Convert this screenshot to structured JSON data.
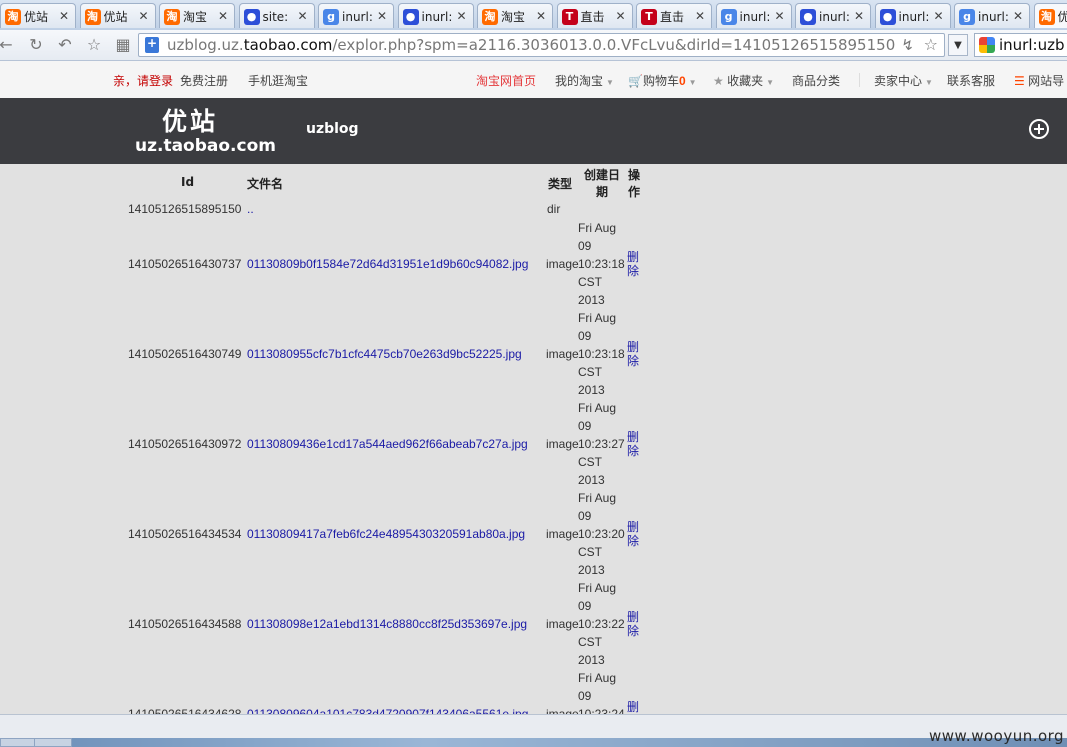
{
  "tabs": [
    {
      "icon": "taobao",
      "title": "优站"
    },
    {
      "icon": "taobao",
      "title": "优站"
    },
    {
      "icon": "taobao",
      "title": "淘宝"
    },
    {
      "icon": "baidu",
      "title": "site:"
    },
    {
      "icon": "google",
      "title": "inurl:"
    },
    {
      "icon": "baidu",
      "title": "inurl:"
    },
    {
      "icon": "taobao",
      "title": "淘宝"
    },
    {
      "icon": "tmall",
      "title": "直击"
    },
    {
      "icon": "tmall",
      "title": "直击"
    },
    {
      "icon": "google",
      "title": "inurl:"
    },
    {
      "icon": "baidu",
      "title": "inurl:"
    },
    {
      "icon": "baidu",
      "title": "inurl:"
    },
    {
      "icon": "google",
      "title": "inurl:"
    },
    {
      "icon": "taobao",
      "title": "优"
    }
  ],
  "address": {
    "scheme_host_prefix": "uzblog.uz.",
    "host_domain": "taobao.com",
    "path": "/explor.php?spm=a2116.3036013.0.0.VFcLvu&dirId=14105126515895150"
  },
  "search": {
    "text": "inurl:uzb"
  },
  "topbar": {
    "login": "亲，请登录",
    "register": "免费注册",
    "mobile": "手机逛淘宝",
    "home": "淘宝网首页",
    "my_taobao": "我的淘宝",
    "cart": "购物车",
    "cart_count": "0",
    "favorites": "收藏夹",
    "categories": "商品分类",
    "seller": "卖家中心",
    "service": "联系客服",
    "site_nav": "网站导"
  },
  "header": {
    "logo_cn": "优站",
    "logo_en": "uz.taobao.com",
    "site_name": "uzblog"
  },
  "table": {
    "headers": {
      "id": "Id",
      "name": "文件名",
      "type": "类型",
      "created_line1": "创建日",
      "created_line2": "期",
      "action_line1": "操",
      "action_line2": "作"
    },
    "parent": {
      "id": "14105126515895150",
      "name": "..",
      "type": "dir"
    },
    "rows": [
      {
        "id": "14105026516430737",
        "name": "01130809b0f1584e72d64d31951e1d9b60c94082.jpg",
        "type": "image",
        "date": [
          "Fri Aug",
          "09",
          "10:23:18",
          "CST",
          "2013"
        ],
        "del": [
          "删",
          "除"
        ]
      },
      {
        "id": "14105026516430749",
        "name": "0113080955cfc7b1cfc4475cb70e263d9bc52225.jpg",
        "type": "image",
        "date": [
          "Fri Aug",
          "09",
          "10:23:18",
          "CST",
          "2013"
        ],
        "del": [
          "删",
          "除"
        ]
      },
      {
        "id": "14105026516430972",
        "name": "01130809436e1cd17a544aed962f66abeab7c27a.jpg",
        "type": "image",
        "date": [
          "Fri Aug",
          "09",
          "10:23:27",
          "CST",
          "2013"
        ],
        "del": [
          "删",
          "除"
        ]
      },
      {
        "id": "14105026516434534",
        "name": "01130809417a7feb6fc24e4895430320591ab80a.jpg",
        "type": "image",
        "date": [
          "Fri Aug",
          "09",
          "10:23:20",
          "CST",
          "2013"
        ],
        "del": [
          "删",
          "除"
        ]
      },
      {
        "id": "14105026516434588",
        "name": "011308098e12a1ebd1314c8880cc8f25d353697e.jpg",
        "type": "image",
        "date": [
          "Fri Aug",
          "09",
          "10:23:22",
          "CST",
          "2013"
        ],
        "del": [
          "删",
          "除"
        ]
      },
      {
        "id": "14105026516434628",
        "name": "01130809604a101c783d4720907f143406a5561e.jpg",
        "type": "image",
        "date": [
          "Fri Aug",
          "09",
          "10:23:24"
        ],
        "del": [
          "删"
        ]
      }
    ]
  },
  "watermark": "www.wooyun.org"
}
